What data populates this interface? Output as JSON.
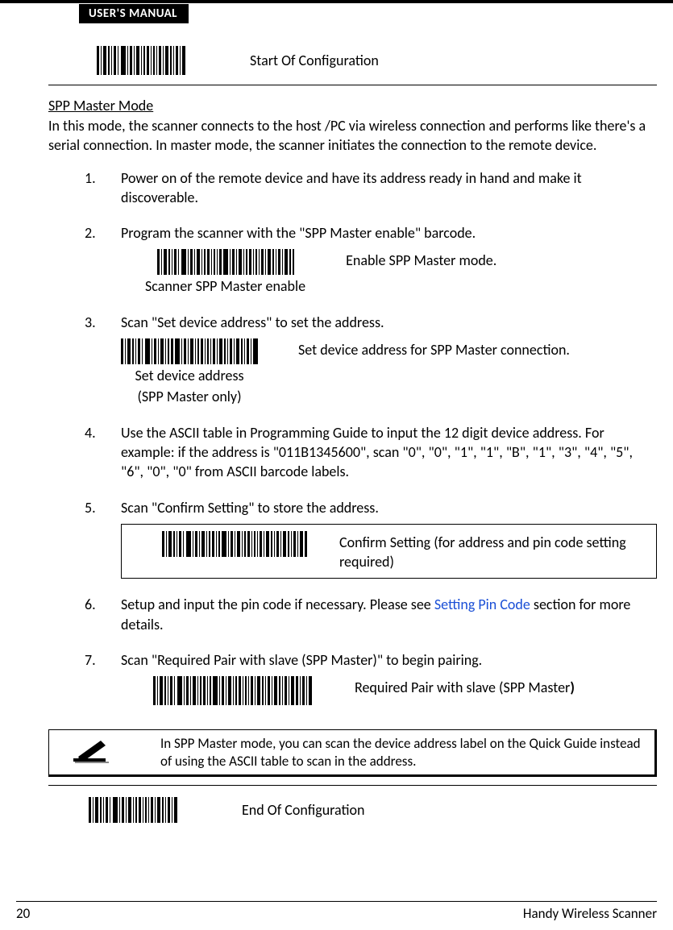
{
  "header": {
    "tab": "USER'S MANUAL"
  },
  "top_barcode": {
    "label": "Start Of Configuration"
  },
  "section": {
    "title": "SPP Master Mode",
    "intro": "In this mode, the scanner connects to the host /PC via wireless connection and performs like there's a serial connection. In master mode, the scanner initiates the connection to the remote device."
  },
  "steps": {
    "s1": "Power on of the remote device and have its address ready in hand and make it discoverable.",
    "s2": "Program the scanner with the \"SPP Master enable\" barcode.",
    "s2_caption": "Scanner SPP Master enable",
    "s2_desc": "Enable SPP Master mode.",
    "s3": "Scan \"Set device address\" to set the address.",
    "s3_caption1": "Set device address",
    "s3_caption2": "(SPP Master only)",
    "s3_desc": "Set device address for SPP Master connection.",
    "s4": "Use the ASCII table in Programming Guide to input the 12 digit device address. For example: if the address is \"011B1345600\", scan \"0\", \"0\", \"1\", \"1\", \"B\", \"1\", \"3\", \"4\", \"5\", \"6\", \"0\", \"0\" from ASCII barcode labels.",
    "s5": "Scan \"Confirm Setting\" to store the address.",
    "s5_desc": "Confirm Setting (for address and pin code setting required)",
    "s6_pre": "Setup and input the pin code if necessary. Please see ",
    "s6_link": "Setting Pin Code",
    "s6_post": " section for more details.",
    "s7": "Scan \"Required Pair with slave (SPP Master)\" to begin pairing.",
    "s7_desc_pre": "Required Pair with slave (SPP Master",
    "s7_desc_bold": ")"
  },
  "note": {
    "text": "In SPP Master mode, you can scan the device address label on the Quick Guide instead of using the ASCII table to scan in the address."
  },
  "end_barcode": {
    "label": "End Of Configuration"
  },
  "footer": {
    "page": "20",
    "title": "Handy Wireless Scanner"
  }
}
